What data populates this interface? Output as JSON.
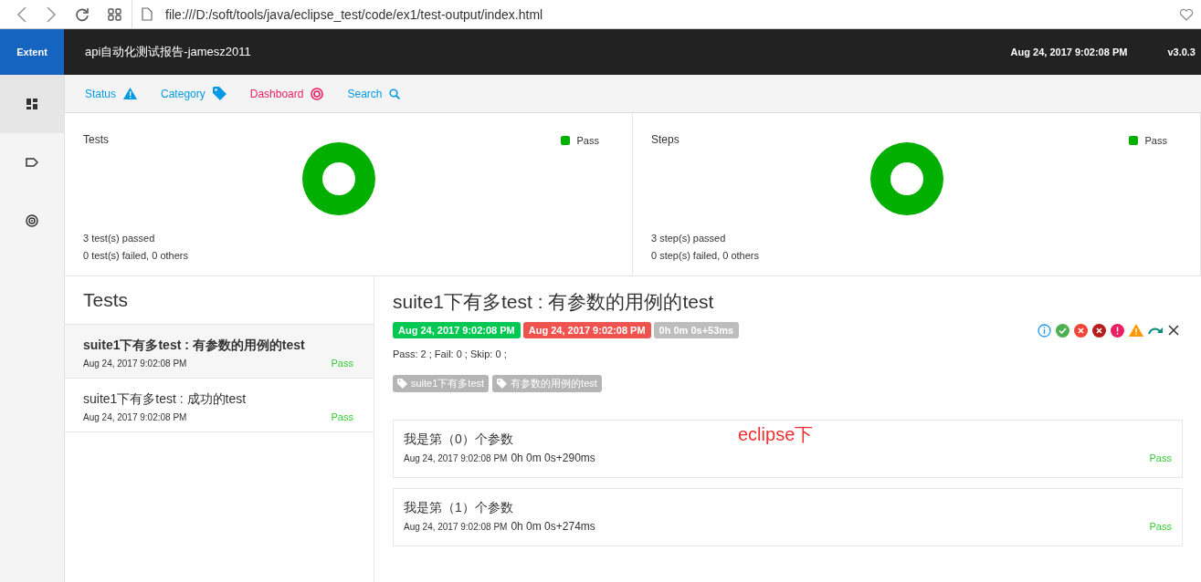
{
  "browser": {
    "url": "file:///D:/soft/tools/java/eclipse_test/code/ex1/test-output/index.html"
  },
  "header": {
    "logo": "Extent",
    "title": "api自动化测试报告-jamesz2011",
    "date": "Aug 24, 2017 9:02:08 PM",
    "version": "v3.0.3"
  },
  "sidebar": {
    "items": [
      {
        "selected": true
      },
      {
        "selected": false
      },
      {
        "selected": false
      }
    ]
  },
  "nav": [
    {
      "label": "Status",
      "selected": false
    },
    {
      "label": "Category",
      "selected": false
    },
    {
      "label": "Dashboard",
      "selected": true
    },
    {
      "label": "Search",
      "selected": false
    }
  ],
  "summary": [
    {
      "title": "Tests",
      "line1_count": "3",
      "line1": "test(s) passed",
      "line2_count": "0",
      "line2_mid": "test(s) failed,",
      "line2_others": "0",
      "line2_end": "others",
      "legend": [
        {
          "label": "Pass",
          "color": "#00af00"
        }
      ]
    },
    {
      "title": "Steps",
      "line1_count": "3",
      "line1": "step(s) passed",
      "line2_count": "0",
      "line2_mid": "step(s) failed,",
      "line2_others": "0",
      "line2_end": "others",
      "legend": [
        {
          "label": "Pass",
          "color": "#00af00"
        }
      ]
    }
  ],
  "tests": {
    "heading": "Tests",
    "items": [
      {
        "name": "suite1下有多test : 有参数的用例的test",
        "time": "Aug 24, 2017 9:02:08 PM",
        "status": "Pass",
        "selected": true
      },
      {
        "name": "suite1下有多test : 成功的test",
        "time": "Aug 24, 2017 9:02:08 PM",
        "status": "Pass",
        "selected": false
      }
    ]
  },
  "detail": {
    "title": "suite1下有多test : 有参数的用例的test",
    "start": "Aug 24, 2017 9:02:08 PM",
    "end": "Aug 24, 2017 9:02:08 PM",
    "duration": "0h 0m 0s+53ms",
    "counts": "Pass: 2 ; Fail: 0 ; Skip: 0 ;",
    "tags": [
      "suite1下有多test",
      "有参数的用例的test"
    ],
    "nodes": [
      {
        "name": "我是第（0）个参数",
        "time": "Aug 24, 2017 9:02:08 PM",
        "duration": "0h 0m 0s+290ms",
        "status": "Pass"
      },
      {
        "name": "我是第（1）个参数",
        "time": "Aug 24, 2017 9:02:08 PM",
        "duration": "0h 0m 0s+274ms",
        "status": "Pass"
      }
    ]
  },
  "annotation": "eclipse下"
}
